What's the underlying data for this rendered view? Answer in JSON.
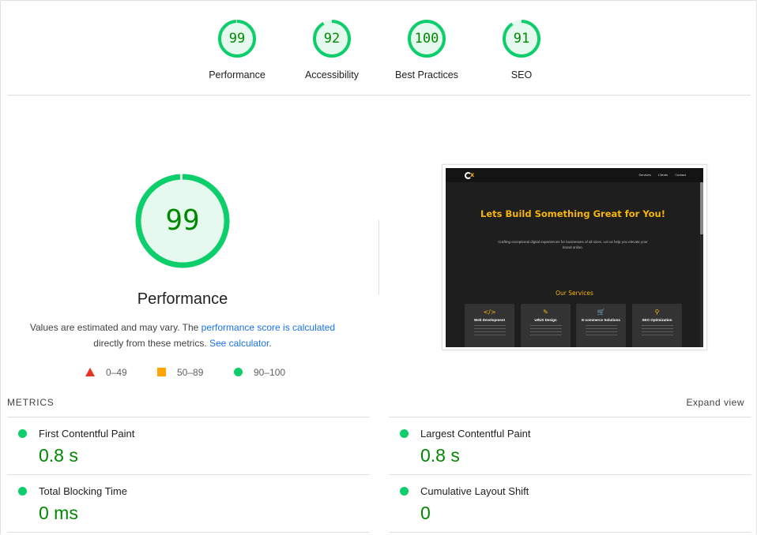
{
  "colors": {
    "pass": "#0cce6b",
    "pass_text": "#008800",
    "average": "#ffa400",
    "fail": "#eb3323",
    "link": "#1a73e8"
  },
  "gauges": [
    {
      "score": "99",
      "label": "Performance",
      "fraction": 0.99
    },
    {
      "score": "92",
      "label": "Accessibility",
      "fraction": 0.92
    },
    {
      "score": "100",
      "label": "Best Practices",
      "fraction": 1.0
    },
    {
      "score": "91",
      "label": "SEO",
      "fraction": 0.91
    }
  ],
  "performance": {
    "score": "99",
    "fraction": 0.99,
    "title": "Performance",
    "desc_prefix": "Values are estimated and may vary. The ",
    "desc_link": "performance score is calculated",
    "desc_middle": " directly from these metrics. ",
    "calc_link": "See calculator",
    "desc_suffix": ".",
    "legend": [
      {
        "icon": "fail-triangle-icon",
        "range": "0–49"
      },
      {
        "icon": "average-square-icon",
        "range": "50–89"
      },
      {
        "icon": "pass-circle-icon",
        "range": "90–100"
      }
    ]
  },
  "screenshot": {
    "nav_links": [
      "Services",
      "Clients",
      "Contact"
    ],
    "hero_title": "Lets Build Something Great for You!",
    "hero_sub": "Crafting exceptional digital experiences for businesses of all sizes. Let us help you elevate your brand online.",
    "services_title": "Our Services",
    "cards": [
      {
        "icon": "code-icon",
        "glyph": "</>",
        "title": "Web Development"
      },
      {
        "icon": "brush-icon",
        "glyph": "✎",
        "title": "UI/UX Design"
      },
      {
        "icon": "cart-icon",
        "glyph": "🛒",
        "title": "E-commerce Solutions"
      },
      {
        "icon": "search-icon",
        "glyph": "⚲",
        "title": "SEO Optimization"
      }
    ]
  },
  "metrics": {
    "heading": "METRICS",
    "expand": "Expand view",
    "items": [
      {
        "name": "First Contentful Paint",
        "value": "0.8 s"
      },
      {
        "name": "Largest Contentful Paint",
        "value": "0.8 s"
      },
      {
        "name": "Total Blocking Time",
        "value": "0 ms"
      },
      {
        "name": "Cumulative Layout Shift",
        "value": "0"
      }
    ]
  }
}
